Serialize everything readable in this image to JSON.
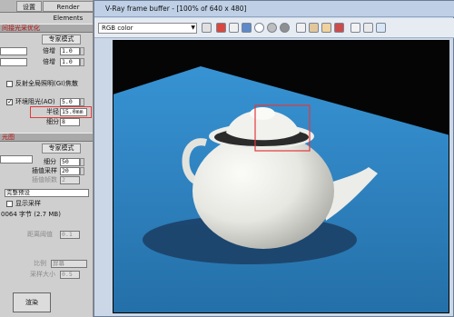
{
  "left_panel": {
    "tabs": [
      "设置",
      "Render Elements"
    ],
    "section_title": "间接光采优化",
    "pro_mode_button": "专家模式",
    "multiplier_label_1": "倍增",
    "multiplier_value_1": "1.0",
    "multiplier_label_2": "倍增",
    "multiplier_value_2": "1.0",
    "gi_caustics_label": "反射全局照明(GI)焦散",
    "ao_label": "环境阻光(AO)",
    "ao_value": "5.0",
    "radius_label": "半径",
    "radius_value": "15.0mm",
    "subdiv_label": "细分",
    "subdiv_value": "8",
    "second_section_title": "光图",
    "pro_mode_button_2": "专家模式",
    "subdivs_label": "细分",
    "subdivs_value": "50",
    "interp_label": "插值采样",
    "interp_value": "20",
    "interp_frames_label": "插值帧数",
    "interp_frames_value": "2",
    "calc_dropdown": "完整预设",
    "show_samples_label": "显示采样",
    "memory_text": "0064 字节 (2.7 MB)",
    "dist_thresh_label": "距离阈值",
    "dist_thresh_value": "0.1",
    "scale_label": "比例",
    "scale_value": "屏幕",
    "sample_size_label": "采样大小",
    "sample_size_value": "0.5",
    "render_button": "渲染"
  },
  "frame_buffer": {
    "title": "V-Ray frame buffer - [100% of 640 x 480]",
    "channel": "RGB color",
    "toolbar_icons": [
      "red-channel-icon",
      "green-channel-icon",
      "blue-channel-icon",
      "alpha-channel-icon",
      "mono-icon",
      "save-icon",
      "load-icon",
      "clear-icon",
      "copy-icon",
      "duplicate-icon",
      "region-icon",
      "tracking-icon",
      "settings-icon",
      "lut-icon"
    ]
  },
  "colors": {
    "panel_bg": "#cfcfcf",
    "accent_red": "#e23a3a",
    "plane_blue": "#2f86c6",
    "teapot": "#ededea",
    "window_border": "#6d7d94"
  }
}
